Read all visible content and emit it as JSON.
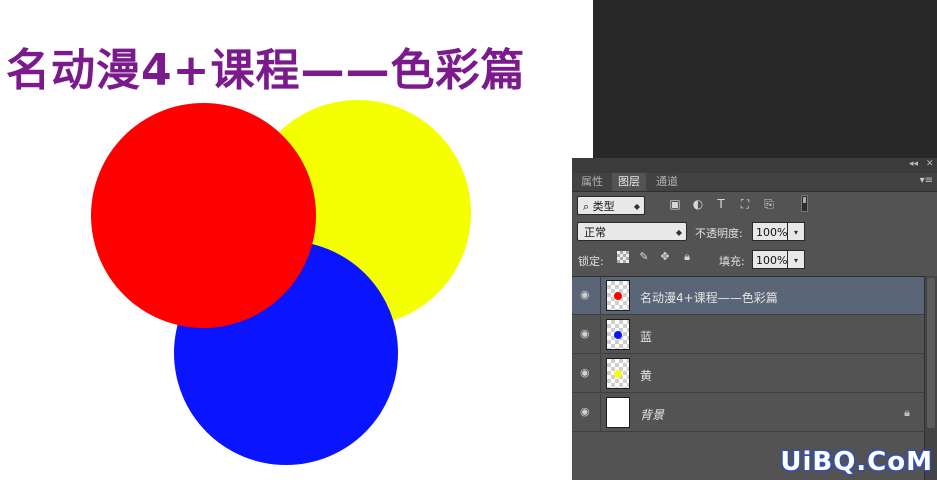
{
  "canvas": {
    "title": "名动漫4+课程——色彩篇",
    "title_color": "#7a1a8c",
    "circles": {
      "red": "#ff0000",
      "yellow": "#f4ff00",
      "blue": "#0a14ff"
    }
  },
  "panel": {
    "collapse_icon": "double-chevron-left-icon",
    "close_icon": "close-icon",
    "tabs": [
      {
        "label": "属性",
        "active": false
      },
      {
        "label": "图层",
        "active": true
      },
      {
        "label": "通道",
        "active": false
      }
    ],
    "menu_icon": "panel-menu-icon",
    "filter": {
      "kind_label": "类型",
      "icons": [
        "image-filter-icon",
        "adjustment-filter-icon",
        "type-filter-icon",
        "shape-filter-icon",
        "smart-object-filter-icon"
      ]
    },
    "blend_mode": "正常",
    "opacity_label": "不透明度:",
    "opacity_value": "100%",
    "lock_label": "锁定:",
    "lock_icons": [
      "lock-transparency-icon",
      "lock-paint-icon",
      "lock-position-icon",
      "lock-all-icon"
    ],
    "fill_label": "填充:",
    "fill_value": "100%",
    "layers": [
      {
        "name": "名动漫4+课程——色彩篇",
        "selected": true,
        "dot_color": "#ff0000"
      },
      {
        "name": "蓝",
        "selected": false,
        "dot_color": "#0a14ff"
      },
      {
        "name": "黄",
        "selected": false,
        "dot_color": "#f4ff00"
      },
      {
        "name": "背景",
        "selected": false,
        "background": true
      }
    ]
  },
  "watermark": "UiBQ.CoM"
}
